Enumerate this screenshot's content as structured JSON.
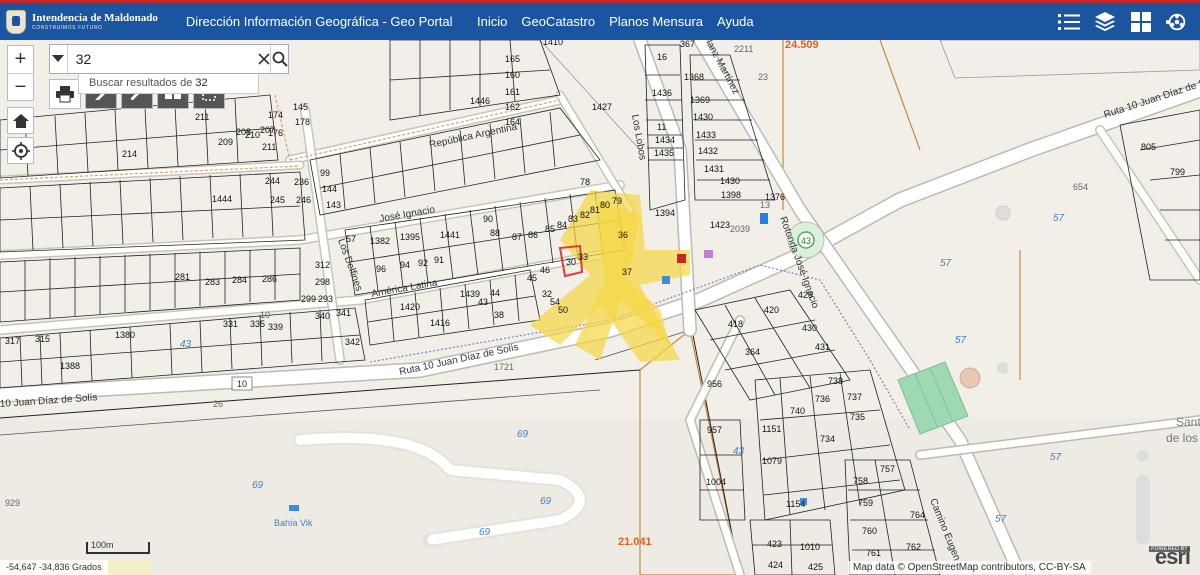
{
  "header": {
    "brand_title": "Intendencia de Maldonado",
    "brand_sub": "CONSTRUIMOS FUTURO",
    "app_title": "Dirección Información Geográfica -  Geo Portal",
    "nav": [
      "Inicio",
      "GeoCatastro",
      "Planos Mensura",
      "Ayuda"
    ]
  },
  "search": {
    "value": "32",
    "suggestion_prefix": "Buscar resultados de ",
    "suggestion_term": "32"
  },
  "map": {
    "streets": {
      "argentina": "República Argentina",
      "argentina2": "República Argentina",
      "jose_ignacio": "José Ignacio",
      "america": "América Latina",
      "ruta": "Ruta 10 Juan Díaz de Solís",
      "ruta_left": "10 Juan Díaz de Solís",
      "ruta_right": "Ruta 10 Juan Díaz de So",
      "lobos": "Los Lobos",
      "delfines": "Los Delfines",
      "rotonda": "Rotonda José Ignacio",
      "martinez": "lanz Martínez",
      "camino": "Camino Eugen",
      "bahia": "Bahía Vik",
      "santa": "Sant",
      "delos": "de los"
    },
    "areas": {
      "a1": "24.509",
      "a2": "21.041"
    },
    "zones": [
      "57",
      "57",
      "57",
      "57",
      "57",
      "69",
      "69",
      "69",
      "69",
      "43",
      "43",
      "654",
      "23",
      "26",
      "10",
      "1721",
      "929",
      "2211",
      "13",
      "2039"
    ],
    "route_shields": [
      "10",
      "43"
    ],
    "parcels": {
      "block_top": [
        "1410",
        "165",
        "160",
        "161",
        "162",
        "164",
        "1446",
        "1427",
        "1436",
        "367",
        "16",
        "1368",
        "1369",
        "1430",
        "1433",
        "1432",
        "1431",
        "1430",
        "1398",
        "1423",
        "1376",
        "1394",
        "11",
        "1434",
        "1435"
      ],
      "block_left": [
        "145",
        "178",
        "174",
        "176",
        "214",
        "211",
        "207",
        "208",
        "209",
        "210",
        "211"
      ],
      "block_mid": [
        "99",
        "144",
        "143",
        "246",
        "244",
        "245",
        "1444",
        "236",
        "1382",
        "1395",
        "1441",
        "57",
        "96",
        "94",
        "92",
        "91",
        "90",
        "88",
        "87",
        "86",
        "85",
        "84",
        "83",
        "82",
        "81",
        "80",
        "79",
        "78"
      ],
      "block_lower": [
        "312",
        "298",
        "293",
        "299",
        "281",
        "283",
        "284",
        "286",
        "1439",
        "1416",
        "1420",
        "317",
        "315",
        "1380",
        "1388",
        "331",
        "335",
        "339",
        "340",
        "341",
        "342",
        "33",
        "36",
        "37",
        "38",
        "43",
        "44",
        "45",
        "46",
        "30",
        "32",
        "54",
        "50",
        "52"
      ],
      "right": [
        "805",
        "799",
        "418",
        "420",
        "429",
        "430",
        "431",
        "364",
        "956",
        "957",
        "1004",
        "1151",
        "1079",
        "1154",
        "740",
        "738",
        "736",
        "737",
        "735",
        "734",
        "757",
        "758",
        "759",
        "760",
        "761",
        "762",
        "764",
        "423",
        "424",
        "1010",
        "425"
      ]
    },
    "coords": "-54,647 -34,836 Grados",
    "scale": "100m",
    "attribution": "Map data © OpenStreetMap contributors, CC-BY-SA",
    "esri_powered": "POWERED BY",
    "esri_word": "esri"
  },
  "colors": {
    "header_bg": "#1b55a0",
    "header_accent": "#c62828",
    "highlight": "#f5d742",
    "selected": "#e53935",
    "area_label": "#e06020"
  }
}
